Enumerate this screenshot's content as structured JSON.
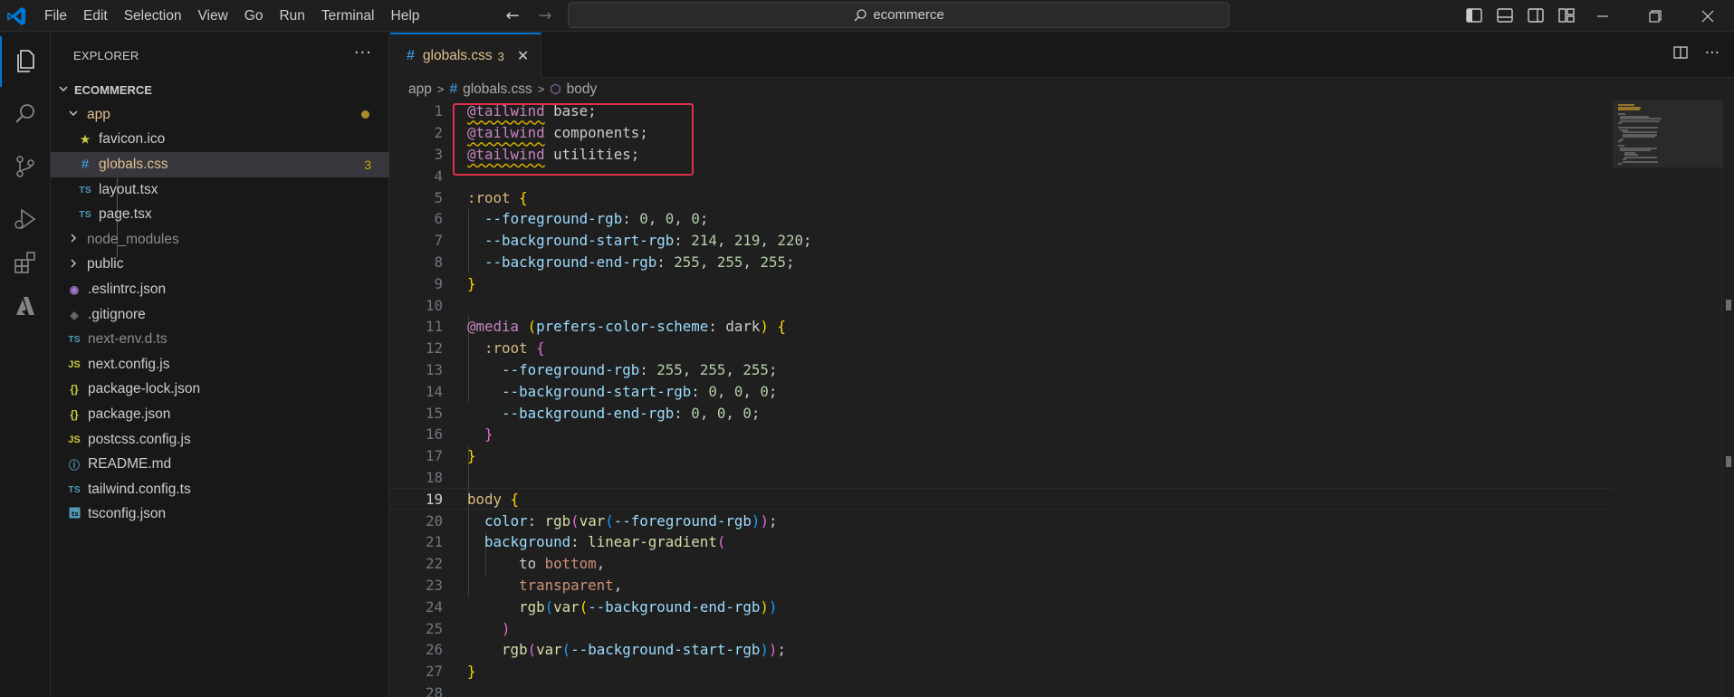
{
  "menu": [
    "File",
    "Edit",
    "Selection",
    "View",
    "Go",
    "Run",
    "Terminal",
    "Help"
  ],
  "search": {
    "text": "ecommerce"
  },
  "explorer": {
    "title": "EXPLORER",
    "more": "···",
    "workspace": "ECOMMERCE",
    "items": [
      {
        "label": "app",
        "icon": "chevron-down",
        "type": "folder",
        "modified": true
      },
      {
        "label": "favicon.ico",
        "icon": "★",
        "type": "ico"
      },
      {
        "label": "globals.css",
        "icon": "#",
        "type": "css",
        "badge": "3"
      },
      {
        "label": "layout.tsx",
        "icon": "TS",
        "type": "ts"
      },
      {
        "label": "page.tsx",
        "icon": "TS",
        "type": "ts"
      },
      {
        "label": "node_modules",
        "icon": "chevron-right",
        "type": "folder"
      },
      {
        "label": "public",
        "icon": "chevron-right",
        "type": "folder"
      },
      {
        "label": ".eslintrc.json",
        "icon": "◉",
        "type": "eslint"
      },
      {
        "label": ".gitignore",
        "icon": "◈",
        "type": "git"
      },
      {
        "label": "next-env.d.ts",
        "icon": "TS",
        "type": "ts"
      },
      {
        "label": "next.config.js",
        "icon": "JS",
        "type": "js"
      },
      {
        "label": "package-lock.json",
        "icon": "{}",
        "type": "json"
      },
      {
        "label": "package.json",
        "icon": "{}",
        "type": "json"
      },
      {
        "label": "postcss.config.js",
        "icon": "JS",
        "type": "js"
      },
      {
        "label": "README.md",
        "icon": "ⓘ",
        "type": "md"
      },
      {
        "label": "tailwind.config.ts",
        "icon": "TS",
        "type": "ts"
      },
      {
        "label": "tsconfig.json",
        "icon": "TS",
        "type": "tsconfig"
      }
    ]
  },
  "tab": {
    "hash": "#",
    "name": "globals.css",
    "problems": "3",
    "close": "✕"
  },
  "breadcrumb": {
    "folder": "app",
    "file": "globals.css",
    "symbol": "body"
  },
  "code": {
    "current_line": 19,
    "lines": [
      [
        [
          "@tailwind",
          "at"
        ],
        [
          " base;",
          "txt"
        ]
      ],
      [
        [
          "@tailwind",
          "at"
        ],
        [
          " components;",
          "txt"
        ]
      ],
      [
        [
          "@tailwind",
          "at"
        ],
        [
          " utilities;",
          "txt"
        ]
      ],
      [],
      [
        [
          ":root",
          "id"
        ],
        [
          " ",
          "txt"
        ],
        [
          "{",
          "br1"
        ]
      ],
      [
        [
          "  ",
          "txt"
        ],
        [
          "--foreground-rgb",
          "prop"
        ],
        [
          ": ",
          "txt"
        ],
        [
          "0",
          "num"
        ],
        [
          ", ",
          "txt"
        ],
        [
          "0",
          "num"
        ],
        [
          ", ",
          "txt"
        ],
        [
          "0",
          "num"
        ],
        [
          ";",
          "txt"
        ]
      ],
      [
        [
          "  ",
          "txt"
        ],
        [
          "--background-start-rgb",
          "prop"
        ],
        [
          ": ",
          "txt"
        ],
        [
          "214",
          "num"
        ],
        [
          ", ",
          "txt"
        ],
        [
          "219",
          "num"
        ],
        [
          ", ",
          "txt"
        ],
        [
          "220",
          "num"
        ],
        [
          ";",
          "txt"
        ]
      ],
      [
        [
          "  ",
          "txt"
        ],
        [
          "--background-end-rgb",
          "prop"
        ],
        [
          ": ",
          "txt"
        ],
        [
          "255",
          "num"
        ],
        [
          ", ",
          "txt"
        ],
        [
          "255",
          "num"
        ],
        [
          ", ",
          "txt"
        ],
        [
          "255",
          "num"
        ],
        [
          ";",
          "txt"
        ]
      ],
      [
        [
          "}",
          "br1"
        ]
      ],
      [],
      [
        [
          "@media",
          "at2"
        ],
        [
          " ",
          "txt"
        ],
        [
          "(",
          "br1"
        ],
        [
          "prefers-color-scheme",
          "prop"
        ],
        [
          ": dark",
          "txt"
        ],
        [
          ")",
          "br1"
        ],
        [
          " ",
          "txt"
        ],
        [
          "{",
          "br1"
        ]
      ],
      [
        [
          "  ",
          "txt"
        ],
        [
          ":root",
          "id"
        ],
        [
          " ",
          "txt"
        ],
        [
          "{",
          "br2"
        ]
      ],
      [
        [
          "    ",
          "txt"
        ],
        [
          "--foreground-rgb",
          "prop"
        ],
        [
          ": ",
          "txt"
        ],
        [
          "255",
          "num"
        ],
        [
          ", ",
          "txt"
        ],
        [
          "255",
          "num"
        ],
        [
          ", ",
          "txt"
        ],
        [
          "255",
          "num"
        ],
        [
          ";",
          "txt"
        ]
      ],
      [
        [
          "    ",
          "txt"
        ],
        [
          "--background-start-rgb",
          "prop"
        ],
        [
          ": ",
          "txt"
        ],
        [
          "0",
          "num"
        ],
        [
          ", ",
          "txt"
        ],
        [
          "0",
          "num"
        ],
        [
          ", ",
          "txt"
        ],
        [
          "0",
          "num"
        ],
        [
          ";",
          "txt"
        ]
      ],
      [
        [
          "    ",
          "txt"
        ],
        [
          "--background-end-rgb",
          "prop"
        ],
        [
          ": ",
          "txt"
        ],
        [
          "0",
          "num"
        ],
        [
          ", ",
          "txt"
        ],
        [
          "0",
          "num"
        ],
        [
          ", ",
          "txt"
        ],
        [
          "0",
          "num"
        ],
        [
          ";",
          "txt"
        ]
      ],
      [
        [
          "  ",
          "txt"
        ],
        [
          "}",
          "br2"
        ]
      ],
      [
        [
          "}",
          "br1"
        ]
      ],
      [],
      [
        [
          "body",
          "id"
        ],
        [
          " ",
          "txt"
        ],
        [
          "{",
          "br1"
        ]
      ],
      [
        [
          "  ",
          "txt"
        ],
        [
          "color",
          "prop"
        ],
        [
          ": ",
          "txt"
        ],
        [
          "rgb",
          "fn"
        ],
        [
          "(",
          "br2"
        ],
        [
          "var",
          "fn"
        ],
        [
          "(",
          "br3"
        ],
        [
          "--foreground-rgb",
          "prop"
        ],
        [
          ")",
          "br3"
        ],
        [
          ")",
          "br2"
        ],
        [
          ";",
          "txt"
        ]
      ],
      [
        [
          "  ",
          "txt"
        ],
        [
          "background",
          "prop"
        ],
        [
          ": ",
          "txt"
        ],
        [
          "linear-gradient",
          "fn"
        ],
        [
          "(",
          "br2"
        ]
      ],
      [
        [
          "      ",
          "txt"
        ],
        [
          "to ",
          "txt"
        ],
        [
          "bottom",
          "val"
        ],
        [
          ",",
          "txt"
        ]
      ],
      [
        [
          "      ",
          "txt"
        ],
        [
          "transparent",
          "val"
        ],
        [
          ",",
          "txt"
        ]
      ],
      [
        [
          "      ",
          "txt"
        ],
        [
          "rgb",
          "fn"
        ],
        [
          "(",
          "br3"
        ],
        [
          "var",
          "fn"
        ],
        [
          "(",
          "br1"
        ],
        [
          "--background-end-rgb",
          "prop"
        ],
        [
          ")",
          "br1"
        ],
        [
          ")",
          "br3"
        ]
      ],
      [
        [
          "    ",
          "txt"
        ],
        [
          ")",
          "br2"
        ]
      ],
      [
        [
          "    ",
          "txt"
        ],
        [
          "rgb",
          "fn"
        ],
        [
          "(",
          "br2"
        ],
        [
          "var",
          "fn"
        ],
        [
          "(",
          "br3"
        ],
        [
          "--background-start-rgb",
          "prop"
        ],
        [
          ")",
          "br3"
        ],
        [
          ")",
          "br2"
        ],
        [
          ";",
          "txt"
        ]
      ],
      [
        [
          "}",
          "br1"
        ]
      ],
      []
    ]
  },
  "colors": {
    "accent": "#0078d4",
    "highlight_box": "#e0304a",
    "modified": "#e2c08d"
  }
}
